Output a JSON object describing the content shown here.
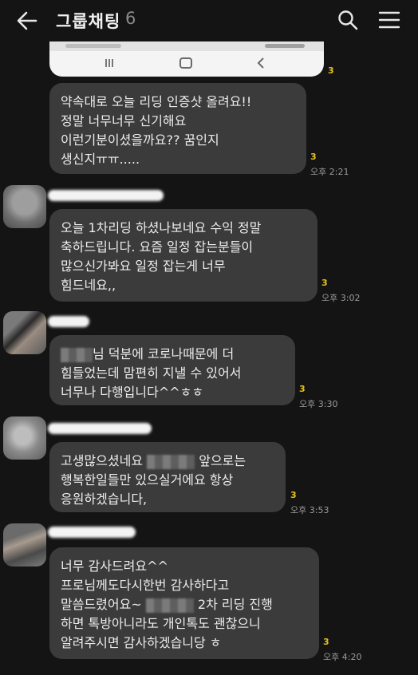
{
  "header": {
    "title": "그룹채팅",
    "member_count": "6"
  },
  "messages": [
    {
      "lines": [
        "약속대로 오늘 리딩 인증샷 올려요!!",
        "정말 너무너무 신기해요",
        "이런기분이셨을까요?? 꿈인지",
        "생신지ㅠㅠ....."
      ],
      "unread": "3",
      "time": "오후 2:21"
    },
    {
      "lines": [
        "오늘 1차리딩 하셨나보네요 수익 정말",
        "축하드립니다. 요즘 일정 잡는분들이",
        "많으신가봐요 일정 잡는게 너무",
        "힘드네요,,"
      ],
      "unread": "3",
      "time": "오후 3:02"
    },
    {
      "line1_after": "님 덕분에 코로나때문에 더",
      "lines_rest": [
        "힘들었는데 맘편히 지낼 수 있어서",
        "너무나 다행입니다^^ㅎㅎ"
      ],
      "unread": "3",
      "time": "오후 3:30"
    },
    {
      "line1_before": "고생많으셨네요",
      "line1_after": "앞으로는",
      "lines_rest": [
        "행복한일들만 있으실거에요 항상",
        "응원하겠습니다,"
      ],
      "unread": "3",
      "time": "오후 3:53"
    },
    {
      "lines_first": [
        "너무 감사드려요^^",
        "프로님께도다시한번 감사하다고"
      ],
      "line3_before": "말씀드렸어요~",
      "line3_after": "2차 리딩 진행",
      "lines_rest": [
        "하면 톡방아니라도 개인톡도 괜찮으니",
        "알려주시면 감사하겠습니당 ㅎ"
      ],
      "unread": "3",
      "time": "오후 4:20"
    }
  ],
  "first_unread": "3",
  "icons": {
    "back": "back-arrow-icon",
    "search": "search-icon",
    "menu": "hamburger-menu-icon"
  }
}
